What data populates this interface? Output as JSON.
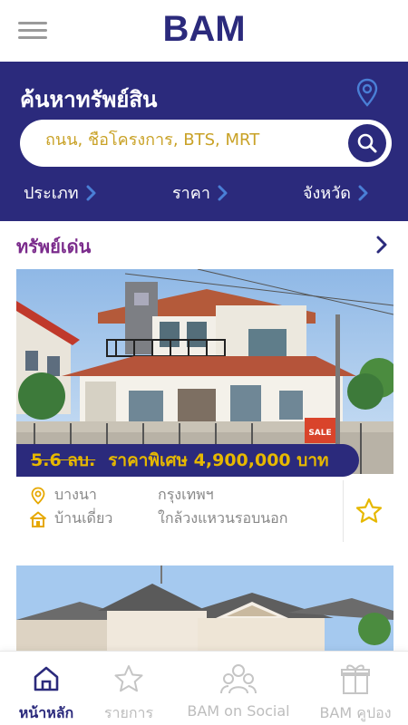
{
  "app": {
    "logo": "BAM"
  },
  "icons": {
    "menu": "hamburger-icon",
    "location": "map-pin-icon",
    "search": "search-icon",
    "chevron": "chevron-right-icon",
    "favorite": "star-icon"
  },
  "colors": {
    "brand": "#2b2a7c",
    "accent": "#e6b800",
    "heading": "#7b2c8c",
    "muted": "#888888"
  },
  "search": {
    "title": "ค้นหาทรัพย์สิน",
    "placeholder": "ถนน, ชื่อโครงการ, BTS, MRT",
    "filters": [
      "ประเภท",
      "ราคา",
      "จังหวัด"
    ]
  },
  "featured": {
    "title": "ทรัพย์เด่น",
    "card": {
      "old_price": "5.6 ลบ.",
      "special_price": "ราคาพิเศษ 4,900,000 บาท",
      "district": "บางนา",
      "province": "กรุงเทพฯ",
      "type": "บ้านเดี่ยว",
      "nearby": "ใกล้วงแหวนรอบนอก",
      "sign_text": "SALE"
    }
  },
  "nav": [
    {
      "label": "หน้าหลัก",
      "icon": "home-icon",
      "active": true
    },
    {
      "label": "รายการ",
      "icon": "star-icon",
      "active": false
    },
    {
      "label": "BAM on Social",
      "icon": "people-icon",
      "active": false
    },
    {
      "label": "BAM คูปอง",
      "icon": "gift-icon",
      "active": false
    }
  ]
}
